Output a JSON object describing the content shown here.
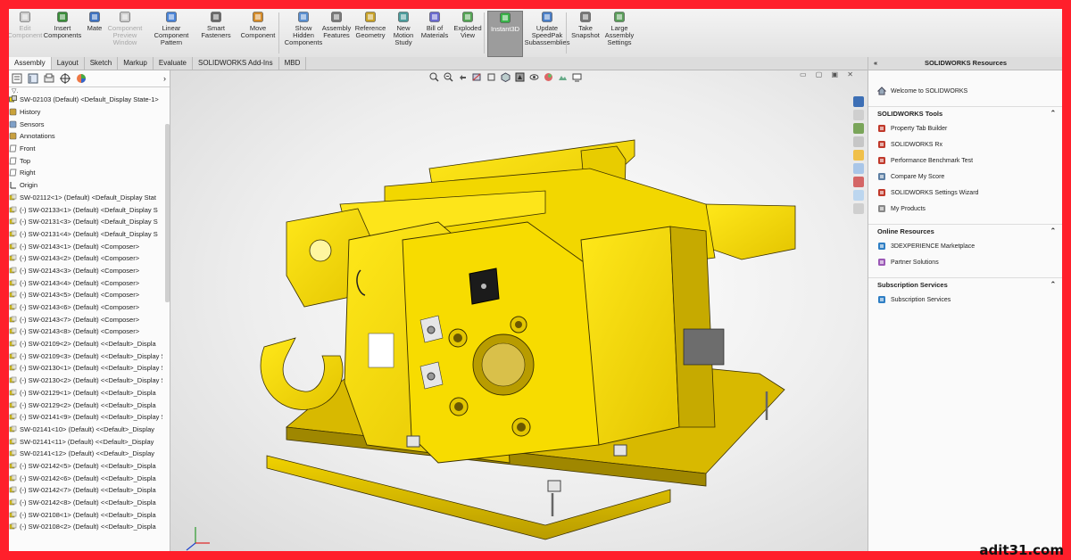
{
  "ribbon": {
    "buttons": [
      {
        "label": "Edit Component",
        "disabled": true
      },
      {
        "label": "Insert Components"
      },
      {
        "label": "Mate"
      },
      {
        "label": "Component Preview Window",
        "disabled": true
      },
      {
        "label": "Linear Component Pattern"
      },
      {
        "label": "Smart Fasteners"
      },
      {
        "label": "Move Component"
      },
      {
        "label": "Show Hidden Components"
      },
      {
        "label": "Assembly Features"
      },
      {
        "label": "Reference Geometry"
      },
      {
        "label": "New Motion Study"
      },
      {
        "label": "Bill of Materials"
      },
      {
        "label": "Exploded View"
      },
      {
        "label": "Instant3D",
        "active": true
      },
      {
        "label": "Update SpeedPak Subassemblies"
      },
      {
        "label": "Take Snapshot"
      },
      {
        "label": "Large Assembly Settings"
      }
    ]
  },
  "tabs": [
    "Assembly",
    "Layout",
    "Sketch",
    "Markup",
    "Evaluate",
    "SOLIDWORKS Add-Ins",
    "MBD"
  ],
  "tree": {
    "root": "SW-02103 (Default) <Default_Display State-1>",
    "items": [
      "History",
      "Sensors",
      "Annotations",
      "Front",
      "Top",
      "Right",
      "Origin",
      "SW-02112<1> (Default) <Default_Display Stat",
      "(-) SW-02133<1> (Default) <Default_Display S",
      "(-) SW-02131<3> (Default) <Default_Display S",
      "(-) SW-02131<4> (Default) <Default_Display S",
      "(-) SW-02143<1> (Default) <Composer>",
      "(-) SW-02143<2> (Default) <Composer>",
      "(-) SW-02143<3> (Default) <Composer>",
      "(-) SW-02143<4> (Default) <Composer>",
      "(-) SW-02143<5> (Default) <Composer>",
      "(-) SW-02143<6> (Default) <Composer>",
      "(-) SW-02143<7> (Default) <Composer>",
      "(-) SW-02143<8> (Default) <Composer>",
      "(-) SW-02109<2> (Default) <<Default>_Displa",
      "(-) SW-02109<3> (Default) <<Default>_Display S",
      "(-) SW-02130<1> (Default) <<Default>_Display S",
      "(-) SW-02130<2> (Default) <<Default>_Display S",
      "(-) SW-02129<1> (Default) <<Default>_Displa",
      "(-) SW-02129<2> (Default) <<Default>_Displa",
      "(-) SW-02141<9> (Default) <<Default>_Display S",
      "SW-02141<10> (Default) <<Default>_Display",
      "SW-02141<11> (Default) <<Default>_Display",
      "SW-02141<12> (Default) <<Default>_Display",
      "(-) SW-02142<5> (Default) <<Default>_Displa",
      "(-) SW-02142<6> (Default) <<Default>_Displa",
      "(-) SW-02142<7> (Default) <<Default>_Displa",
      "(-) SW-02142<8> (Default) <<Default>_Displa",
      "(-) SW-02108<1> (Default) <<Default>_Displa",
      "(-) SW-02108<2> (Default) <<Default>_Displa"
    ]
  },
  "resources": {
    "title": "SOLIDWORKS Resources",
    "welcome": "Welcome to SOLIDWORKS",
    "sections": [
      {
        "title": "SOLIDWORKS Tools",
        "items": [
          "Property Tab Builder",
          "SOLIDWORKS Rx",
          "Performance Benchmark Test",
          "Compare My Score",
          "SOLIDWORKS Settings Wizard",
          "My Products"
        ]
      },
      {
        "title": "Online Resources",
        "items": [
          "3DEXPERIENCE Marketplace",
          "Partner Solutions"
        ]
      },
      {
        "title": "Subscription Services",
        "items": [
          "Subscription Services"
        ]
      }
    ]
  },
  "watermark": "adit31.com",
  "colors": {
    "frame": "#ff1f2b",
    "model": "#f5d800",
    "model_dark": "#b89c00",
    "model_edge": "#3a3000"
  }
}
